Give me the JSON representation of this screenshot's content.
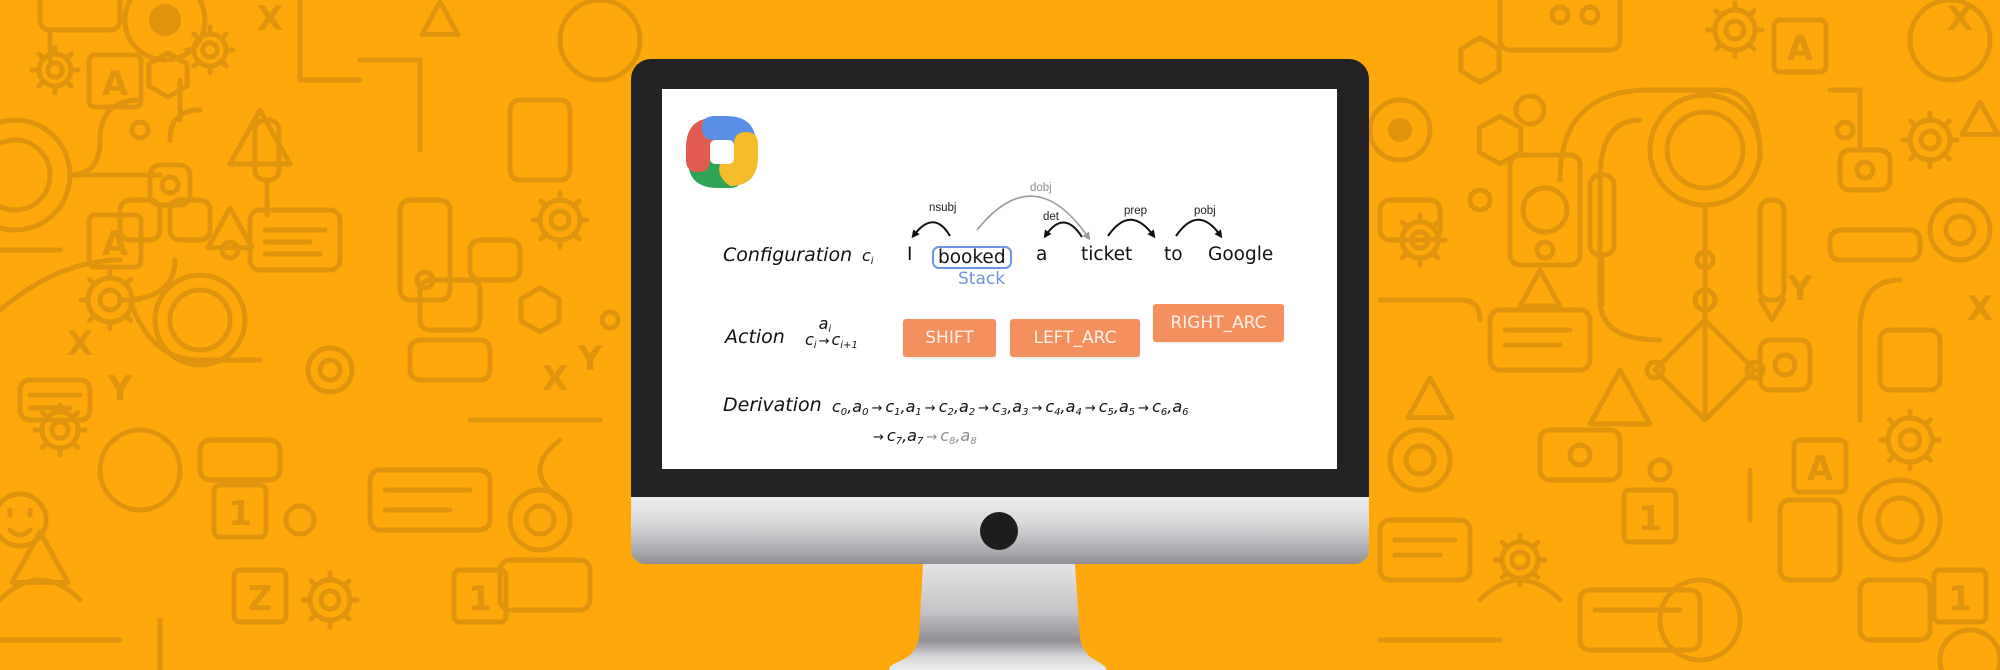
{
  "colors": {
    "background": "#FFA80B",
    "pattern": "#E0930C",
    "bezel": "#222222",
    "action_button": "#F4905E",
    "stack_accent": "#6E95E0",
    "logo": {
      "red": "#E15B4F",
      "blue": "#5A8FE8",
      "yellow": "#F6BB2A",
      "green": "#2EA455"
    }
  },
  "background": {
    "pattern_icons": [
      "gear-icon",
      "letter-a-icon",
      "letter-x-icon",
      "letter-y-icon",
      "triangle-icon",
      "hexagon-icon",
      "eye-icon",
      "brain-icon",
      "phone-icon",
      "python-icon",
      "chip-icon",
      "pencil-icon",
      "lightbulb-icon",
      "circuit-line"
    ]
  },
  "slide": {
    "configuration": {
      "label": "Configuration",
      "symbol": "c",
      "symbol_sub": "i",
      "words": [
        "I",
        "booked",
        "a",
        "ticket",
        "to",
        "Google"
      ],
      "stack_word": "booked",
      "stack_label": "Stack",
      "arcs": [
        {
          "label": "nsubj",
          "from": "booked",
          "to": "I"
        },
        {
          "label": "dobj",
          "from": "booked",
          "to": "ticket"
        },
        {
          "label": "det",
          "from": "ticket",
          "to": "a"
        },
        {
          "label": "prep",
          "from": "ticket",
          "to": "to"
        },
        {
          "label": "pobj",
          "from": "to",
          "to": "Google"
        }
      ]
    },
    "action": {
      "label": "Action",
      "formula": {
        "left": "c",
        "left_sub": "i",
        "over": "a",
        "over_sub": "i",
        "arrow": "→",
        "right": "c",
        "right_sub": "i+1"
      },
      "buttons": [
        "SHIFT",
        "LEFT_ARC",
        "RIGHT_ARC"
      ]
    },
    "derivation": {
      "label": "Derivation",
      "line1": [
        {
          "c": "0",
          "a": "0"
        },
        {
          "c": "1",
          "a": "1"
        },
        {
          "c": "2",
          "a": "2"
        },
        {
          "c": "3",
          "a": "3"
        },
        {
          "c": "4",
          "a": "4"
        },
        {
          "c": "5",
          "a": "5"
        },
        {
          "c": "6",
          "a": "6"
        }
      ],
      "line2": [
        {
          "c": "7",
          "a": "7"
        },
        {
          "c": "8",
          "a": "8"
        }
      ],
      "arrow": "→"
    }
  }
}
